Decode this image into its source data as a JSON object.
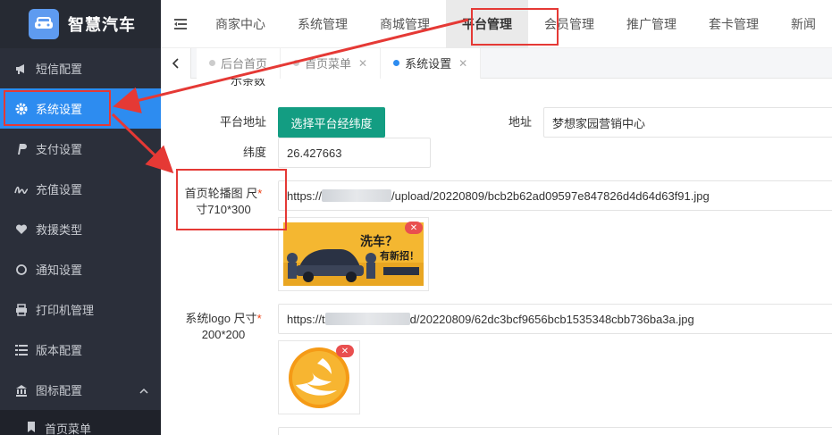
{
  "app": {
    "title": "智慧汽车",
    "logo_icon": "car-icon"
  },
  "sidebar": {
    "items": [
      {
        "label": "短信配置",
        "icon": "megaphone-icon"
      },
      {
        "label": "系统设置",
        "icon": "gear-icon",
        "active": true
      },
      {
        "label": "支付设置",
        "icon": "paypal-icon"
      },
      {
        "label": "充值设置",
        "icon": "signature-icon"
      },
      {
        "label": "救援类型",
        "icon": "heart-icon"
      },
      {
        "label": "通知设置",
        "icon": "power-icon"
      },
      {
        "label": "打印机管理",
        "icon": "printer-icon"
      },
      {
        "label": "版本配置",
        "icon": "list-icon"
      },
      {
        "label": "图标配置",
        "icon": "bank-icon"
      }
    ],
    "subitem": "首页菜单"
  },
  "topnav": {
    "items": [
      "商家中心",
      "系统管理",
      "商城管理",
      "平台管理",
      "会员管理",
      "推广管理",
      "套卡管理",
      "新闻"
    ],
    "active": "平台管理"
  },
  "tabs": [
    {
      "label": "后台首页"
    },
    {
      "label": "首页菜单"
    },
    {
      "label": "系统设置",
      "active": true
    }
  ],
  "form": {
    "cut_label": "示条数",
    "address_label": "平台地址",
    "address_button": "选择平台经纬度",
    "location_label": "地址",
    "location_value": "梦想家园营销中心",
    "latitude_label": "纬度",
    "latitude_value": "26.427663",
    "banner_label_1": "首页轮播图 尺",
    "banner_label_2": "寸710*300",
    "banner_url_prefix": "https://",
    "banner_url_suffix": "/upload/20220809/bcb2b62ad09597e847826d4d64d63f91.jpg",
    "banner_image_text": "洗车？",
    "banner_image_text2": "有新招！",
    "logo_label_1": "系统logo 尺寸",
    "logo_label_2": "200*200",
    "logo_url_prefix": "https://t",
    "logo_url_suffix": "d/20220809/62dc3bcf9656bcb1535348cbb736ba3a.jpg"
  },
  "colors": {
    "accent": "#2d8cf0",
    "sidebar": "#2b2f3a",
    "green": "#139d82",
    "annotation": "#e53935"
  }
}
